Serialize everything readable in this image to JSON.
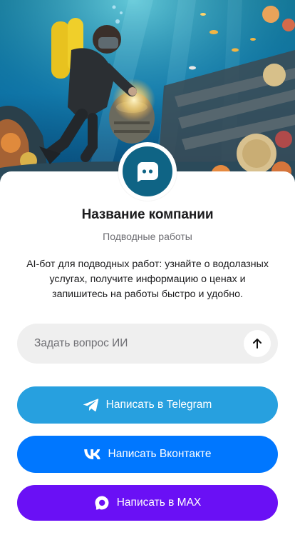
{
  "profile": {
    "company_name": "Название компании",
    "subtitle": "Подводные работы",
    "description": "AI-бот для подводных работ: узнайте о водолазных услугах, получите информацию о ценах и запишитесь на работы быстро и удобно."
  },
  "ask": {
    "placeholder": "Задать вопрос ИИ",
    "value": ""
  },
  "buttons": {
    "telegram": "Написать в Telegram",
    "vk": "Написать Вконтакте",
    "max": "Написать в MAX"
  },
  "icons": {
    "hero": "underwater-diver-illustration",
    "avatar": "chat-bot-icon",
    "send": "arrow-up-icon",
    "telegram": "telegram-icon",
    "vk": "vk-icon",
    "max": "max-icon"
  },
  "colors": {
    "avatar_bg": "#0f6485",
    "telegram": "#27a0df",
    "vk": "#0077ff",
    "max": "#6a10f5",
    "input_bg": "#efefef"
  }
}
